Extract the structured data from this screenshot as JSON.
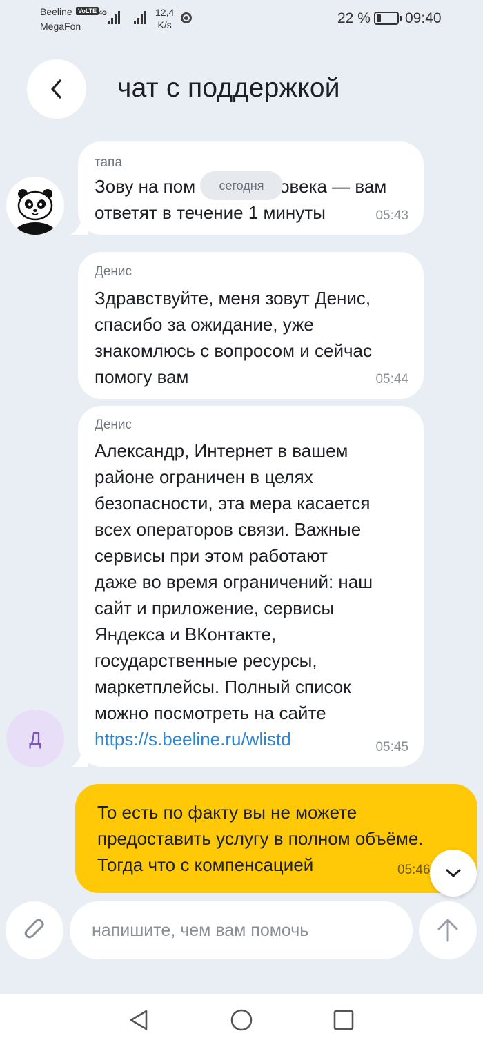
{
  "status_bar": {
    "carrier_1": "Beeline",
    "carrier_1_badge": "VoLTE",
    "carrier_2": "MegaFon",
    "network": "4G",
    "speed_value": "12,4",
    "speed_unit": "K/s",
    "battery_text": "22 %",
    "battery_level": 0.22,
    "time": "09:40"
  },
  "header": {
    "title": "чат с поддержкой",
    "back_icon": "chevron-left-icon"
  },
  "date_separator": "сегодня",
  "messages": [
    {
      "sender": "тапа",
      "text": "Зову на помощь человека — вам ответят в течение 1 минуты",
      "lines": [
        "Зову на пом",
        "овека — вам",
        "ответят в течение 1 минуты"
      ],
      "time": "05:43"
    },
    {
      "sender": "Денис",
      "lines": [
        "Здравствуйте, меня зовут Денис,",
        "спасибо за ожидание, уже",
        "знакомлюсь с вопросом и сейчас",
        "помогу вам"
      ],
      "time": "05:44"
    },
    {
      "sender": "Денис",
      "lines": [
        "Александр, Интернет в вашем",
        "районе ограничен в целях",
        "безопасности, эта мера касается",
        "всех операторов связи. Важные",
        "сервисы при этом работают",
        "даже во время ограничений: наш",
        "сайт и приложение, сервисы",
        "Яндекса и ВКонтакте,",
        "государственные ресурсы,",
        "маркетплейсы. Полный список",
        "можно посмотреть на сайте"
      ],
      "link": "https://s.beeline.ru/wlistd",
      "time": "05:45"
    },
    {
      "sender": "user",
      "lines": [
        "То есть по факту вы не можете",
        "предоставить услугу в полном объёме.",
        "Тогда что с компенсацией"
      ],
      "time": "05:46"
    }
  ],
  "avatars": {
    "bot": "panda-avatar",
    "operator_initial": "Д"
  },
  "input": {
    "placeholder": "напишите, чем вам помочь",
    "value": ""
  },
  "icons": {
    "attach": "paperclip-icon",
    "send": "arrow-up-icon",
    "scroll": "chevron-down-icon"
  },
  "colors": {
    "background": "#e9edf4",
    "user_bubble": "#ffc908",
    "link": "#2a86d6",
    "operator_avatar_bg": "#e8def8"
  }
}
